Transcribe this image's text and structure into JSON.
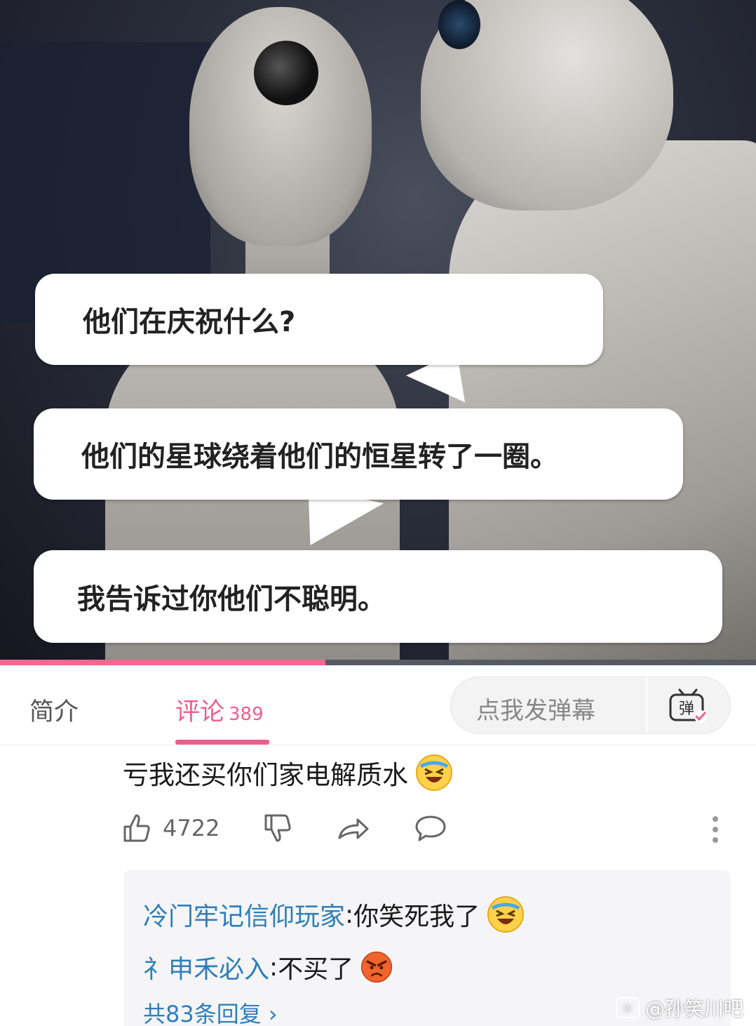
{
  "video": {
    "bubbles": [
      "他们在庆祝什么?",
      "他们的星球绕着他们的恒星转了一圈。",
      "我告诉过你他们不聪明。"
    ],
    "progress_fraction": 0.43,
    "accent_color": "#ec5f8c"
  },
  "tabs": {
    "intro_label": "简介",
    "comments_label": "评论",
    "comments_count": "389",
    "danmaku_placeholder": "点我发弹幕",
    "danmaku_icon_char": "弹"
  },
  "comment": {
    "text": "亏我还买你们家电解质水",
    "emoji": "laughing-crying-emoji",
    "likes": "4722"
  },
  "replies": {
    "items": [
      {
        "user": "冷门牢记信仰玩家",
        "sep": ": ",
        "text": "你笑死我了",
        "emoji": "laughing-crying-emoji"
      },
      {
        "user": "礻申禾必入",
        "sep": ": ",
        "text": "不买了",
        "emoji": "angry-emoji"
      }
    ],
    "total_label": "共83条回复 ›"
  },
  "watermark": {
    "text": "@孙笑川吧"
  }
}
